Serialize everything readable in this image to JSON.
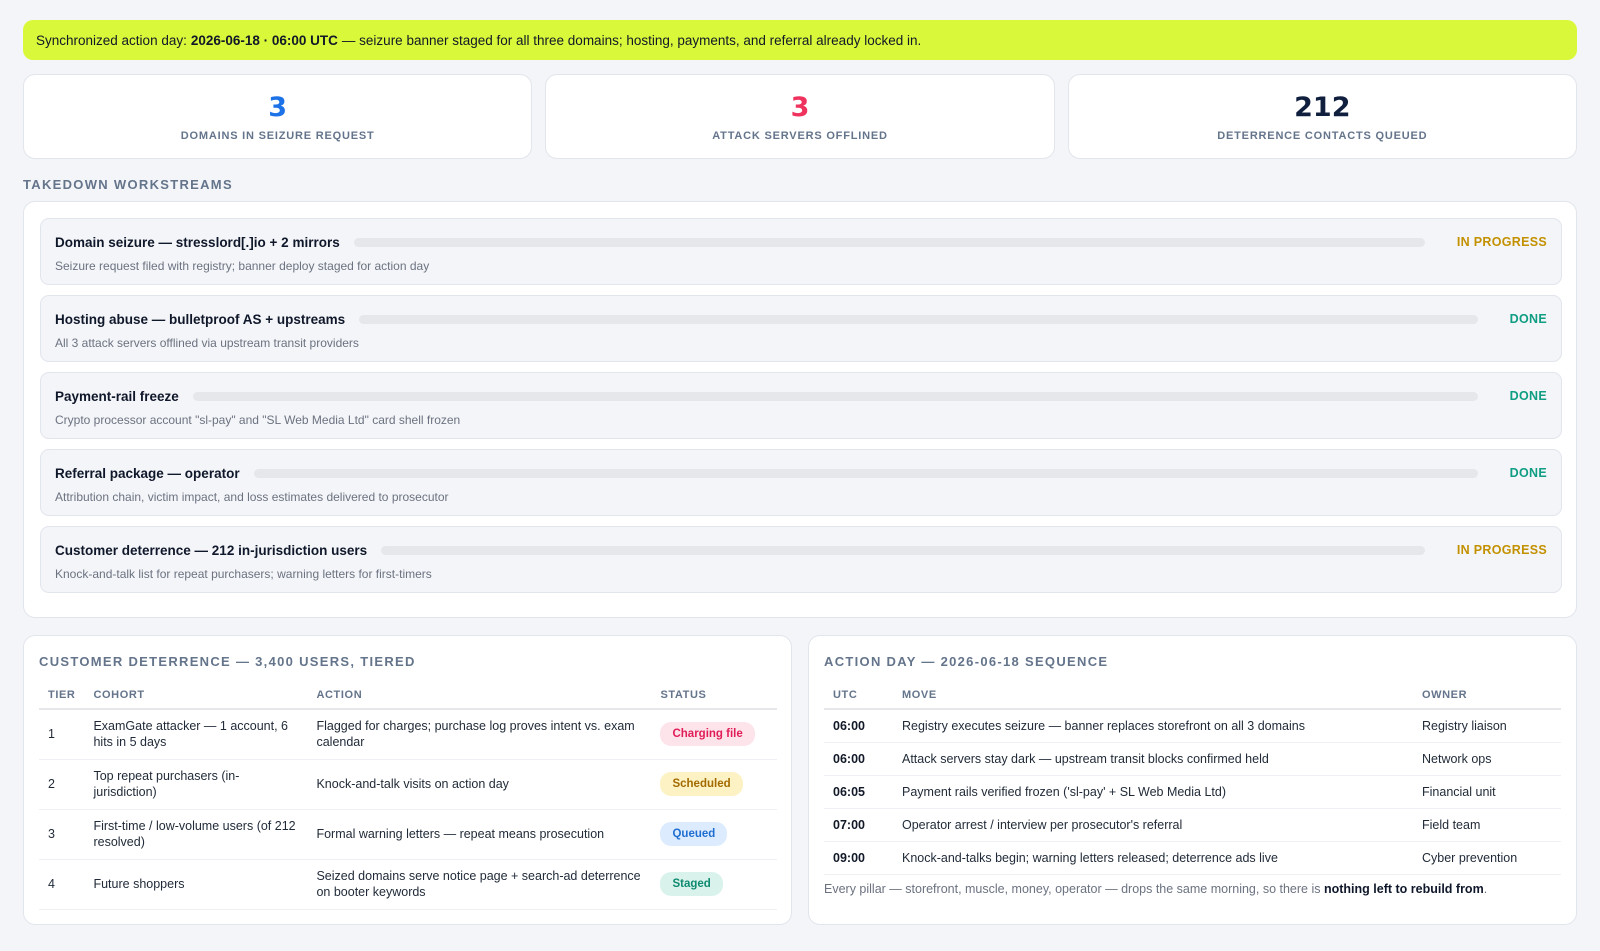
{
  "banner": {
    "prefix": "Synchronized action day:",
    "emphasis": "2026-06-18 · 06:00 UTC",
    "suffix": "— seizure banner staged for all three domains; hosting, payments, and referral already locked in."
  },
  "stats": [
    {
      "value": "3",
      "label": "Domains in seizure request",
      "color": "#1d72e8"
    },
    {
      "value": "3",
      "label": "Attack servers offlined",
      "color": "#f0325e"
    },
    {
      "value": "212",
      "label": "Deterrence contacts queued",
      "color": "#0f1f3d"
    }
  ],
  "workstreams": {
    "title": "Takedown workstreams",
    "items": [
      {
        "name": "Domain seizure — stresslord[.]io + 2 mirrors",
        "desc": "Seizure request filed with registry; banner deploy staged for action day",
        "status": "IN PROGRESS",
        "status_color": "#c39100",
        "progress": 0.0
      },
      {
        "name": "Hosting abuse — bulletproof AS + upstreams",
        "desc": "All 3 attack servers offlined via upstream transit providers",
        "status": "DONE",
        "status_color": "#0f9d83",
        "progress": 0.0
      },
      {
        "name": "Payment-rail freeze",
        "desc": "Crypto processor account \"sl-pay\" and \"SL Web Media Ltd\" card shell frozen",
        "status": "DONE",
        "status_color": "#0f9d83",
        "progress": 0.0
      },
      {
        "name": "Referral package — operator",
        "desc": "Attribution chain, victim impact, and loss estimates delivered to prosecutor",
        "status": "DONE",
        "status_color": "#0f9d83",
        "progress": 0.0
      },
      {
        "name": "Customer deterrence — 212 in-jurisdiction users",
        "desc": "Knock-and-talk list for repeat purchasers; warning letters for first-timers",
        "status": "IN PROGRESS",
        "status_color": "#c39100",
        "progress": 0.0
      }
    ]
  },
  "deterrence": {
    "title": "Customer deterrence — 3,400 users, tiered",
    "headers": [
      "Tier",
      "Cohort",
      "Action",
      "Status"
    ],
    "rows": [
      {
        "tier": "1",
        "cohort": "ExamGate attacker — 1 account, 6 hits in 5 days",
        "action": "Flagged for charges; purchase log proves intent vs. exam calendar",
        "status": "Charging file",
        "bg": "#fde4ea",
        "fg": "#e11d58"
      },
      {
        "tier": "2",
        "cohort": "Top repeat purchasers (in-jurisdiction)",
        "action": "Knock-and-talk visits on action day",
        "status": "Scheduled",
        "bg": "#fdf2c4",
        "fg": "#a36a00"
      },
      {
        "tier": "3",
        "cohort": "First-time / low-volume users (of 212 resolved)",
        "action": "Formal warning letters — repeat means prosecution",
        "status": "Queued",
        "bg": "#dcebfd",
        "fg": "#1f6fd1"
      },
      {
        "tier": "4",
        "cohort": "Future shoppers",
        "action": "Seized domains serve notice page + search-ad deterrence on booter keywords",
        "status": "Staged",
        "bg": "#d9f3ec",
        "fg": "#0f8a70"
      }
    ]
  },
  "action_day": {
    "title": "Action day — 2026-06-18 sequence",
    "headers": [
      "UTC",
      "Move",
      "Owner"
    ],
    "rows": [
      {
        "utc": "06:00",
        "move": "Registry executes seizure — banner replaces storefront on all 3 domains",
        "owner": "Registry liaison"
      },
      {
        "utc": "06:00",
        "move": "Attack servers stay dark — upstream transit blocks confirmed held",
        "owner": "Network ops"
      },
      {
        "utc": "06:05",
        "move": "Payment rails verified frozen ('sl-pay' + SL Web Media Ltd)",
        "owner": "Financial unit"
      },
      {
        "utc": "07:00",
        "move": "Operator arrest / interview per prosecutor's referral",
        "owner": "Field team"
      },
      {
        "utc": "09:00",
        "move": "Knock-and-talks begin; warning letters released; deterrence ads live",
        "owner": "Cyber prevention"
      }
    ],
    "footnote_prefix": "Every pillar — storefront, muscle, money, operator — drops the same morning, so there is",
    "footnote_emphasis": "nothing left to rebuild from",
    "footnote_suffix": "."
  }
}
